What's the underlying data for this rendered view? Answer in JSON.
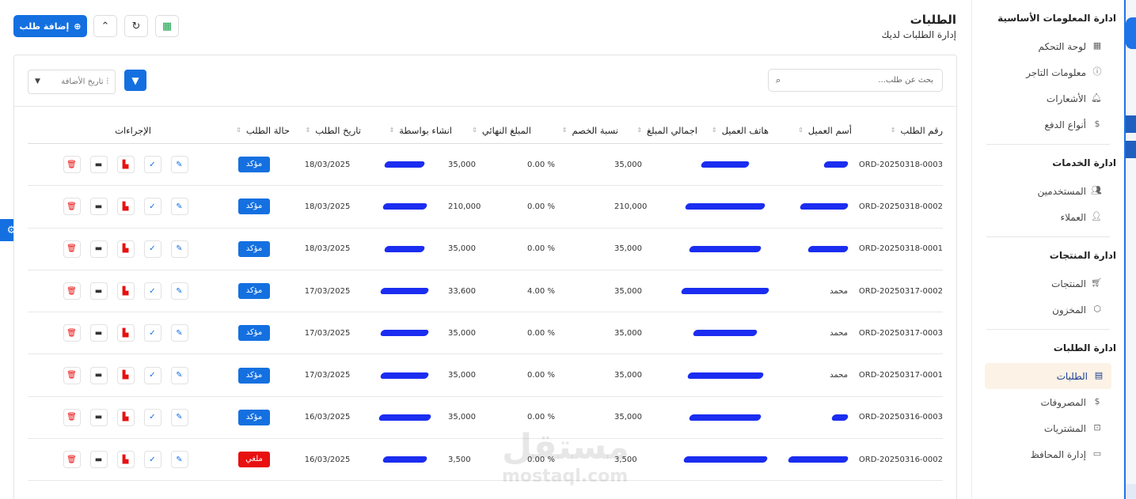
{
  "page": {
    "title": "الطلبات",
    "subtitle": "إدارة الطلبات لديك",
    "add_button": "إضافة طلب"
  },
  "sidebar": {
    "sections": [
      {
        "title": "ادارة المعلومات الأساسية",
        "items": [
          {
            "label": "لوحة التحكم",
            "icon": "grid-icon",
            "glyph": "▦"
          },
          {
            "label": "معلومات التاجر",
            "icon": "info-icon",
            "glyph": "ⓘ"
          },
          {
            "label": "الأشعارات",
            "icon": "bell-icon",
            "glyph": "🔔︎"
          },
          {
            "label": "أنواع الدفع",
            "icon": "dollar-icon",
            "glyph": "$"
          }
        ]
      },
      {
        "title": "ادارة الخدمات",
        "items": [
          {
            "label": "المستخدمين",
            "icon": "users-icon",
            "glyph": "👥︎"
          },
          {
            "label": "العملاء",
            "icon": "user-check-icon",
            "glyph": "👤︎"
          }
        ]
      },
      {
        "title": "ادارة المنتجات",
        "items": [
          {
            "label": "المنتجات",
            "icon": "cart-icon",
            "glyph": "🛒︎"
          },
          {
            "label": "المخزون",
            "icon": "box-icon",
            "glyph": "⬡"
          }
        ]
      },
      {
        "title": "ادارة الطلبات",
        "items": [
          {
            "label": "الطلبات",
            "icon": "document-icon",
            "glyph": "▤",
            "active": true
          },
          {
            "label": "المصروفات",
            "icon": "dollar-icon",
            "glyph": "$"
          },
          {
            "label": "المشتريات",
            "icon": "bag-icon",
            "glyph": "⊡"
          },
          {
            "label": "إدارة المحافظ",
            "icon": "wallet-icon",
            "glyph": "▭"
          }
        ]
      }
    ]
  },
  "toolbar": {
    "search_placeholder": "بحث عن طلب...",
    "sort_label": "تاريخ الأضافة"
  },
  "table": {
    "headers": [
      "رقم الطلب",
      "أسم العميل",
      "هاتف العميل",
      "اجمالي المبلغ",
      "نسبة الخصم",
      "المبلغ النهائي",
      "انشاء بواسطة",
      "تاريخ الطلب",
      "حالة الطلب",
      "الإجراءات"
    ],
    "rows": [
      {
        "id": "ORD-20250318-0003",
        "name": "",
        "total": "35,000",
        "discount": "% 0.00",
        "final": "35,000",
        "date": "18/03/2025",
        "status": "مؤكد",
        "status_color": "#1470e0"
      },
      {
        "id": "ORD-20250318-0002",
        "name": "",
        "total": "210,000",
        "discount": "% 0.00",
        "final": "210,000",
        "date": "18/03/2025",
        "status": "مؤكد",
        "status_color": "#1470e0"
      },
      {
        "id": "ORD-20250318-0001",
        "name": "",
        "total": "35,000",
        "discount": "% 0.00",
        "final": "35,000",
        "date": "18/03/2025",
        "status": "مؤكد",
        "status_color": "#1470e0"
      },
      {
        "id": "ORD-20250317-0002",
        "name": "محمد",
        "total": "35,000",
        "discount": "% 4.00",
        "final": "33,600",
        "date": "17/03/2025",
        "status": "مؤكد",
        "status_color": "#1470e0"
      },
      {
        "id": "ORD-20250317-0003",
        "name": "محمد",
        "total": "35,000",
        "discount": "% 0.00",
        "final": "35,000",
        "date": "17/03/2025",
        "status": "مؤكد",
        "status_color": "#1470e0"
      },
      {
        "id": "ORD-20250317-0001",
        "name": "محمد",
        "total": "35,000",
        "discount": "% 0.00",
        "final": "35,000",
        "date": "17/03/2025",
        "status": "مؤكد",
        "status_color": "#1470e0"
      },
      {
        "id": "ORD-20250316-0003",
        "name": "",
        "total": "35,000",
        "discount": "% 0.00",
        "final": "35,000",
        "date": "16/03/2025",
        "status": "مؤكد",
        "status_color": "#1470e0"
      },
      {
        "id": "ORD-20250316-0002",
        "name": "",
        "total": "3,500",
        "discount": "% 0.00",
        "final": "3,500",
        "date": "16/03/2025",
        "status": "ملغي",
        "status_color": "#e81010"
      }
    ]
  },
  "watermark": {
    "arabic": "مستقل",
    "latin": "mostaql.com"
  },
  "colors": {
    "primary": "#1470e0",
    "cancelled": "#e81010",
    "active_bg": "#fdf2e6"
  }
}
